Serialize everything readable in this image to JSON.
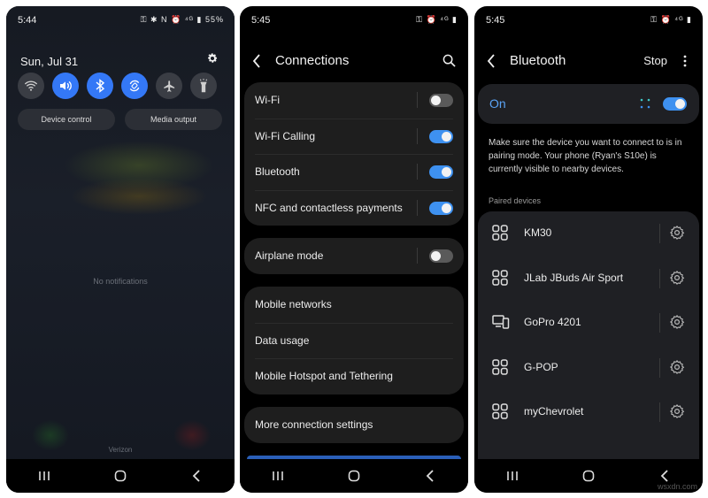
{
  "panel1": {
    "time": "5:44",
    "status_icons": "⚿ ✱ N ⏰ ⁴ᴳ ▮ 55%",
    "date": "Sun, Jul 31",
    "quick_tiles": [
      {
        "name": "wifi",
        "on": false
      },
      {
        "name": "sound",
        "on": true
      },
      {
        "name": "bluetooth",
        "on": true
      },
      {
        "name": "auto-rotate",
        "on": true
      },
      {
        "name": "airplane",
        "on": false
      },
      {
        "name": "flashlight",
        "on": false
      }
    ],
    "device_control_label": "Device control",
    "media_output_label": "Media output",
    "no_notifications": "No notifications",
    "carrier": "Verizon"
  },
  "panel2": {
    "time": "5:45",
    "status_icons": "⚿ ⏰ ⁴ᴳ ▮",
    "title": "Connections",
    "group1": [
      {
        "label": "Wi-Fi",
        "on": false
      },
      {
        "label": "Wi-Fi Calling",
        "on": true
      },
      {
        "label": "Bluetooth",
        "on": true
      },
      {
        "label": "NFC and contactless payments",
        "on": true
      }
    ],
    "group2": [
      {
        "label": "Airplane mode",
        "on": false
      }
    ],
    "group3": [
      {
        "label": "Mobile networks"
      },
      {
        "label": "Data usage"
      },
      {
        "label": "Mobile Hotspot and Tethering"
      }
    ],
    "group4": [
      {
        "label": "More connection settings"
      }
    ]
  },
  "panel3": {
    "time": "5:45",
    "status_icons": "⚿ ⏰ ⁴ᴳ ▮",
    "title": "Bluetooth",
    "stop_label": "Stop",
    "on_label": "On",
    "description": "Make sure the device you want to connect to is in pairing mode. Your phone (Ryan's S10e) is currently visible to nearby devices.",
    "paired_header": "Paired devices",
    "devices": [
      {
        "name": "KM30",
        "icon": "generic-device-icon"
      },
      {
        "name": "JLab JBuds Air Sport",
        "icon": "generic-device-icon"
      },
      {
        "name": "GoPro 4201",
        "icon": "computer-phone-icon"
      },
      {
        "name": "G-POP",
        "icon": "generic-device-icon"
      },
      {
        "name": "myChevrolet",
        "icon": "generic-device-icon"
      }
    ],
    "watermark": "wsxdn.com"
  },
  "colors": {
    "accent": "#3e91f0",
    "tile_on": "#3478f6",
    "on_text": "#5aa3f5"
  }
}
